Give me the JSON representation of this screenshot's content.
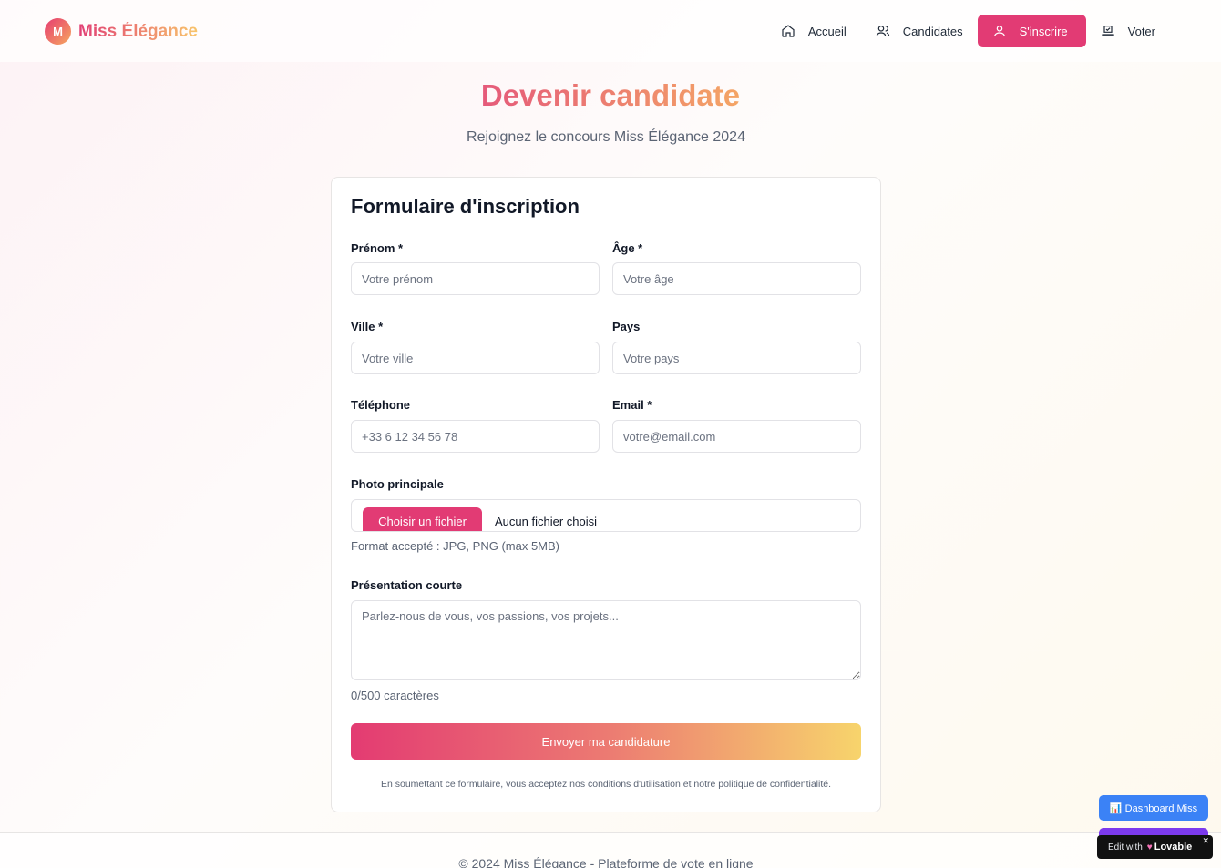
{
  "brand": {
    "logo_letter": "M",
    "name": "Miss Élégance"
  },
  "nav": [
    {
      "label": "Accueil",
      "icon": "home-icon",
      "active": false
    },
    {
      "label": "Candidates",
      "icon": "users-icon",
      "active": false
    },
    {
      "label": "S'inscrire",
      "icon": "user-icon",
      "active": true
    },
    {
      "label": "Voter",
      "icon": "vote-icon",
      "active": false
    }
  ],
  "page": {
    "title": "Devenir candidate",
    "subtitle": "Rejoignez le concours Miss Élégance 2024"
  },
  "form": {
    "title": "Formulaire d'inscription",
    "fields": {
      "prenom": {
        "label": "Prénom *",
        "placeholder": "Votre prénom",
        "value": ""
      },
      "age": {
        "label": "Âge *",
        "placeholder": "Votre âge",
        "value": ""
      },
      "ville": {
        "label": "Ville *",
        "placeholder": "Votre ville",
        "value": ""
      },
      "pays": {
        "label": "Pays",
        "placeholder": "Votre pays",
        "value": ""
      },
      "telephone": {
        "label": "Téléphone",
        "placeholder": "+33 6 12 34 56 78",
        "value": ""
      },
      "email": {
        "label": "Email *",
        "placeholder": "votre@email.com",
        "value": ""
      }
    },
    "photo": {
      "label": "Photo principale",
      "button": "Choisir un fichier",
      "status": "Aucun fichier choisi",
      "hint": "Format accepté : JPG, PNG (max 5MB)"
    },
    "presentation": {
      "label": "Présentation courte",
      "placeholder": "Parlez-nous de vous, vos passions, vos projets...",
      "counter": "0/500 caractères"
    },
    "submit": "Envoyer ma candidature",
    "terms": "En soumettant ce formulaire, vous acceptez nos conditions d'utilisation et notre politique de confidentialité."
  },
  "footer": {
    "text": "© 2024 Miss Élégance - Plateforme de vote en ligne"
  },
  "widgets": {
    "dashboard": "📊 Dashboard Miss",
    "edit_with": "Edit with",
    "lovable": "Lovable",
    "close": "✕"
  },
  "colors": {
    "primary": "#e23b74",
    "accent": "#f6a85f",
    "dashboard_blue": "#3b82f6"
  }
}
